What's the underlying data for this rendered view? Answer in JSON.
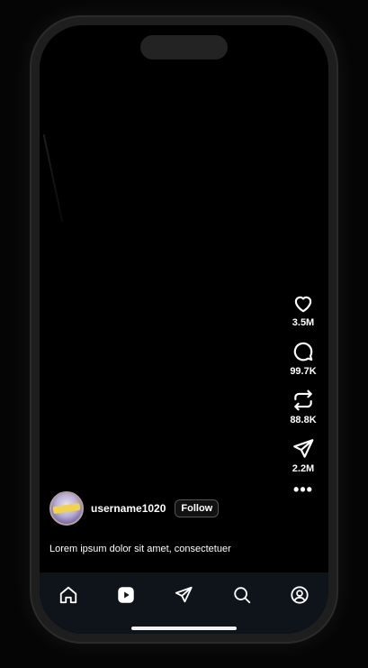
{
  "post": {
    "username": "username1020",
    "follow_label": "Follow",
    "caption": "Lorem ipsum dolor sit amet, consectetuer"
  },
  "actions": {
    "likes": "3.5M",
    "comments": "99.7K",
    "reposts": "88.8K",
    "shares": "2.2M",
    "more": "•••"
  },
  "icons": {
    "like": "heart-icon",
    "comment": "comment-bubble-icon",
    "repost": "repost-icon",
    "share": "send-icon",
    "more": "more-dots-icon",
    "nav": [
      "home-icon",
      "reels-icon",
      "send-icon",
      "search-icon",
      "profile-icon"
    ]
  },
  "colors": {
    "background": "#000000",
    "nav_background": "#0f141b",
    "text": "#ffffff"
  }
}
